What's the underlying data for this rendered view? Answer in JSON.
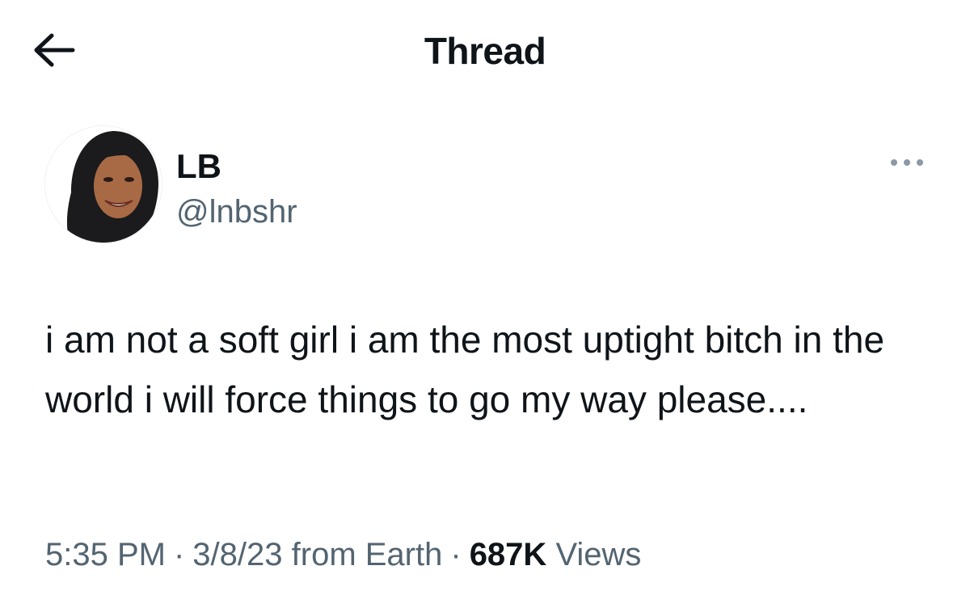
{
  "header": {
    "title": "Thread",
    "back_icon": "arrow-left-icon"
  },
  "author": {
    "display_name": "LB",
    "handle": "@lnbshr",
    "more_icon": "more-horizontal-icon"
  },
  "tweet": {
    "text": "i am not a soft girl i am the most uptight bitch in the world i will force things to go my way please....",
    "time": "5:35 PM",
    "date": "3/8/23",
    "source": "from Earth",
    "separator": "·",
    "views_count": "687K",
    "views_label": "Views"
  },
  "colors": {
    "text_primary": "#0f1419",
    "text_secondary": "#536471",
    "background": "#ffffff"
  }
}
